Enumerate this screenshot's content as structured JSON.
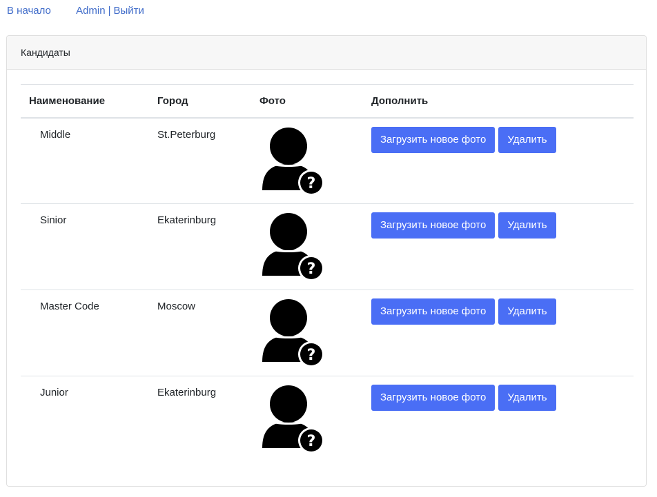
{
  "nav": {
    "home": "В начало",
    "user": "Admin",
    "separator": "|",
    "logout": "Выйти"
  },
  "card": {
    "title": "Кандидаты"
  },
  "table": {
    "headers": {
      "name": "Наименование",
      "city": "Город",
      "photo": "Фото",
      "actions": "Дополнить"
    },
    "rows": [
      {
        "name": "Middle",
        "city": "St.Peterburg",
        "upload_label": "Загрузить новое фото",
        "delete_label": "Удалить"
      },
      {
        "name": "Sinior",
        "city": "Ekaterinburg",
        "upload_label": "Загрузить новое фото",
        "delete_label": "Удалить"
      },
      {
        "name": "Master Code",
        "city": "Moscow",
        "upload_label": "Загрузить новое фото",
        "delete_label": "Удалить"
      },
      {
        "name": "Junior",
        "city": "Ekaterinburg",
        "upload_label": "Загрузить новое фото",
        "delete_label": "Удалить"
      }
    ]
  },
  "icons": {
    "avatar": "unknown-user-icon"
  },
  "colors": {
    "link": "#3f6bc9",
    "button": "#4a6ef5",
    "header_bg": "#f7f7f7"
  }
}
